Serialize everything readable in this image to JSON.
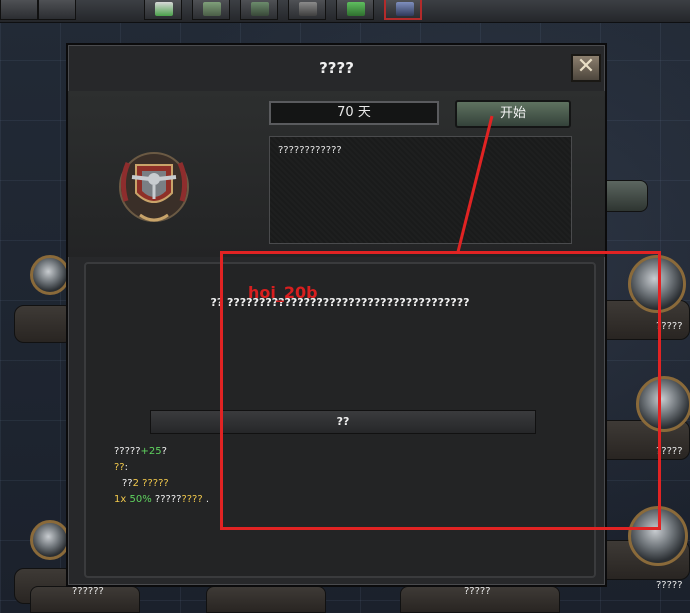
{
  "background": {
    "topbar_buttons": [
      {
        "icon": "science-flask-icon"
      },
      {
        "icon": "industry-crate-icon"
      },
      {
        "icon": "factory-icon"
      },
      {
        "icon": "logistics-icon"
      },
      {
        "icon": "army-icon"
      },
      {
        "icon": "intelligence-icon"
      }
    ],
    "side_labels": {
      "right_1": "?????",
      "right_2": "?????",
      "right_3": "?????",
      "bottom_1": "??????",
      "bottom_2": "?????"
    }
  },
  "dialog": {
    "title": "????",
    "close_label": "✕",
    "days_value": "70 天",
    "start_label": "开始",
    "description": "????????????",
    "bottom_heading": "?? ??????????????????????????????????????",
    "section_title": "??",
    "effects": {
      "line1_prefix": "?????",
      "line1_value": "+25",
      "line1_suffix": "?",
      "line2_label": "??",
      "line2_colon": ":",
      "line3_prefix": "??",
      "line3_value": "2 ?????",
      "line4_multiplier": "1x",
      "line4_percent": "50%",
      "line4_white": "?????",
      "line4_yellow": "????",
      "line4_end": "."
    }
  },
  "annotation": {
    "label": "hoi_20b",
    "color": "#e12323"
  },
  "colors": {
    "accent_green": "#5fd35f",
    "accent_yellow": "#f2c94c",
    "start_button": "#4f6251"
  }
}
